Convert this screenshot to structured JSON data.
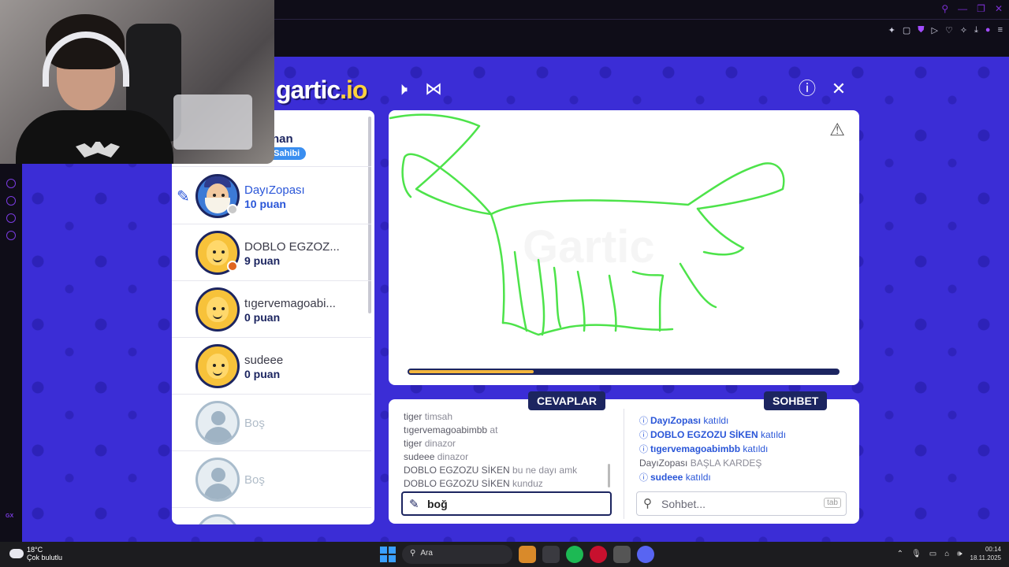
{
  "game": {
    "logo_text": "gartic",
    "logo_io": ".io",
    "owner_badge": "a Sahibi",
    "top_player_name": "nan"
  },
  "players": [
    {
      "name": "DayıZopası",
      "score": "10 puan"
    },
    {
      "name": "DOBLO EGZOZ...",
      "score": "9 puan"
    },
    {
      "name": "tıgervemagoabi...",
      "score": "0 puan"
    },
    {
      "name": "sudeee",
      "score": "0 puan"
    },
    {
      "name": "Boş"
    },
    {
      "name": "Boş"
    }
  ],
  "timer_progress": 0.29,
  "tabs": {
    "answers": "CEVAPLAR",
    "chat": "SOHBET"
  },
  "answers": [
    {
      "user": "tiger",
      "msg": "timsah"
    },
    {
      "user": "tıgervemagoabimbb",
      "msg": "at"
    },
    {
      "user": "tiger",
      "msg": "dinazor"
    },
    {
      "user": "sudeee",
      "msg": "dinazor"
    },
    {
      "user": "DOBLO EGZOZU SİKEN",
      "msg": "bu ne dayı amk"
    },
    {
      "user": "DOBLO EGZOZU SİKEN",
      "msg": "kunduz"
    }
  ],
  "answer_input": {
    "value": "boğ"
  },
  "chat": [
    {
      "user": "DayıZopası",
      "msg": "katıldı",
      "system": true
    },
    {
      "user": "DOBLO EGZOZU SİKEN",
      "msg": "katıldı",
      "system": true
    },
    {
      "user": "tıgervemagoabimbb",
      "msg": "katıldı",
      "system": true
    },
    {
      "user": "DayıZopası",
      "msg": "BAŞLA KARDEŞ",
      "system": false
    },
    {
      "user": "sudeee",
      "msg": "katıldı",
      "system": true
    }
  ],
  "chat_input": {
    "placeholder": "Sohbet...",
    "tab_hint": "tab"
  },
  "taskbar": {
    "temp": "18°C",
    "weather": "Çok bulutlu",
    "search": "Ara",
    "time": "00:14",
    "date": "18.11.2025"
  },
  "colors": {
    "game_bg": "#3b2dd6",
    "navy": "#1c2560",
    "accent_blue": "#2a56d8",
    "stroke_green": "#4de34a",
    "timer": "#f3b63e"
  }
}
